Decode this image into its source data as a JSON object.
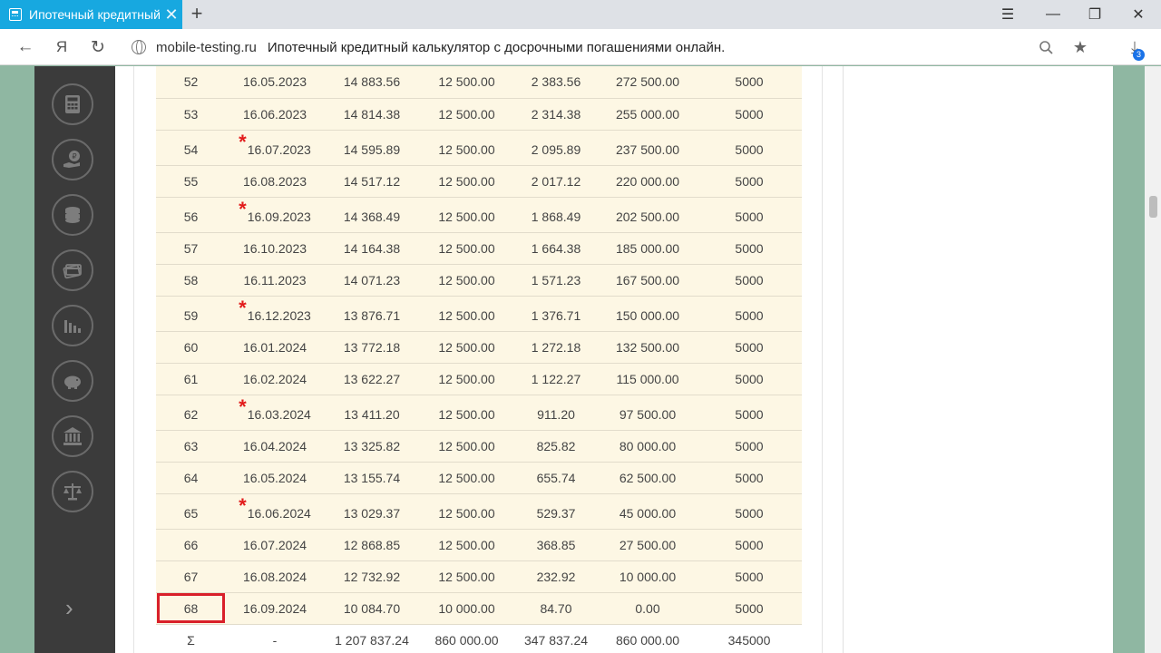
{
  "browser": {
    "tab_title": "Ипотечный кредитный",
    "tab_close": "✕",
    "new_tab": "+",
    "url_domain": "mobile-testing.ru",
    "page_title": "Ипотечный кредитный калькулятор с досрочными погашениями онлайн.",
    "download_count": "3"
  },
  "table": {
    "rows": [
      {
        "n": "52",
        "date": "16.05.2023",
        "payment": "14 883.56",
        "principal": "12 500.00",
        "interest": "2 383.56",
        "balance": "272 500.00",
        "extra": "5000",
        "star": false
      },
      {
        "n": "53",
        "date": "16.06.2023",
        "payment": "14 814.38",
        "principal": "12 500.00",
        "interest": "2 314.38",
        "balance": "255 000.00",
        "extra": "5000",
        "star": false
      },
      {
        "n": "54",
        "date": "16.07.2023",
        "payment": "14 595.89",
        "principal": "12 500.00",
        "interest": "2 095.89",
        "balance": "237 500.00",
        "extra": "5000",
        "star": true
      },
      {
        "n": "55",
        "date": "16.08.2023",
        "payment": "14 517.12",
        "principal": "12 500.00",
        "interest": "2 017.12",
        "balance": "220 000.00",
        "extra": "5000",
        "star": false
      },
      {
        "n": "56",
        "date": "16.09.2023",
        "payment": "14 368.49",
        "principal": "12 500.00",
        "interest": "1 868.49",
        "balance": "202 500.00",
        "extra": "5000",
        "star": true
      },
      {
        "n": "57",
        "date": "16.10.2023",
        "payment": "14 164.38",
        "principal": "12 500.00",
        "interest": "1 664.38",
        "balance": "185 000.00",
        "extra": "5000",
        "star": false
      },
      {
        "n": "58",
        "date": "16.11.2023",
        "payment": "14 071.23",
        "principal": "12 500.00",
        "interest": "1 571.23",
        "balance": "167 500.00",
        "extra": "5000",
        "star": false
      },
      {
        "n": "59",
        "date": "16.12.2023",
        "payment": "13 876.71",
        "principal": "12 500.00",
        "interest": "1 376.71",
        "balance": "150 000.00",
        "extra": "5000",
        "star": true
      },
      {
        "n": "60",
        "date": "16.01.2024",
        "payment": "13 772.18",
        "principal": "12 500.00",
        "interest": "1 272.18",
        "balance": "132 500.00",
        "extra": "5000",
        "star": false
      },
      {
        "n": "61",
        "date": "16.02.2024",
        "payment": "13 622.27",
        "principal": "12 500.00",
        "interest": "1 122.27",
        "balance": "115 000.00",
        "extra": "5000",
        "star": false
      },
      {
        "n": "62",
        "date": "16.03.2024",
        "payment": "13 411.20",
        "principal": "12 500.00",
        "interest": "911.20",
        "balance": "97 500.00",
        "extra": "5000",
        "star": true
      },
      {
        "n": "63",
        "date": "16.04.2024",
        "payment": "13 325.82",
        "principal": "12 500.00",
        "interest": "825.82",
        "balance": "80 000.00",
        "extra": "5000",
        "star": false
      },
      {
        "n": "64",
        "date": "16.05.2024",
        "payment": "13 155.74",
        "principal": "12 500.00",
        "interest": "655.74",
        "balance": "62 500.00",
        "extra": "5000",
        "star": false
      },
      {
        "n": "65",
        "date": "16.06.2024",
        "payment": "13 029.37",
        "principal": "12 500.00",
        "interest": "529.37",
        "balance": "45 000.00",
        "extra": "5000",
        "star": true
      },
      {
        "n": "66",
        "date": "16.07.2024",
        "payment": "12 868.85",
        "principal": "12 500.00",
        "interest": "368.85",
        "balance": "27 500.00",
        "extra": "5000",
        "star": false
      },
      {
        "n": "67",
        "date": "16.08.2024",
        "payment": "12 732.92",
        "principal": "12 500.00",
        "interest": "232.92",
        "balance": "10 000.00",
        "extra": "5000",
        "star": false
      },
      {
        "n": "68",
        "date": "16.09.2024",
        "payment": "10 084.70",
        "principal": "10 000.00",
        "interest": "84.70",
        "balance": "0.00",
        "extra": "5000",
        "star": false,
        "highlighted": true
      }
    ],
    "star_symbol": "*",
    "summary": {
      "n": "Σ",
      "date": "-",
      "payment": "1 207 837.24",
      "principal": "860 000.00",
      "interest": "347 837.24",
      "balance": "860 000.00",
      "extra": "345000"
    }
  },
  "sidebar": {
    "icons": [
      "calculator-icon",
      "ruble-hand-icon",
      "coins-icon",
      "cards-icon",
      "chart-down-icon",
      "piggy-bank-icon",
      "bank-icon",
      "scales-icon"
    ],
    "expand_arrow": "›"
  }
}
